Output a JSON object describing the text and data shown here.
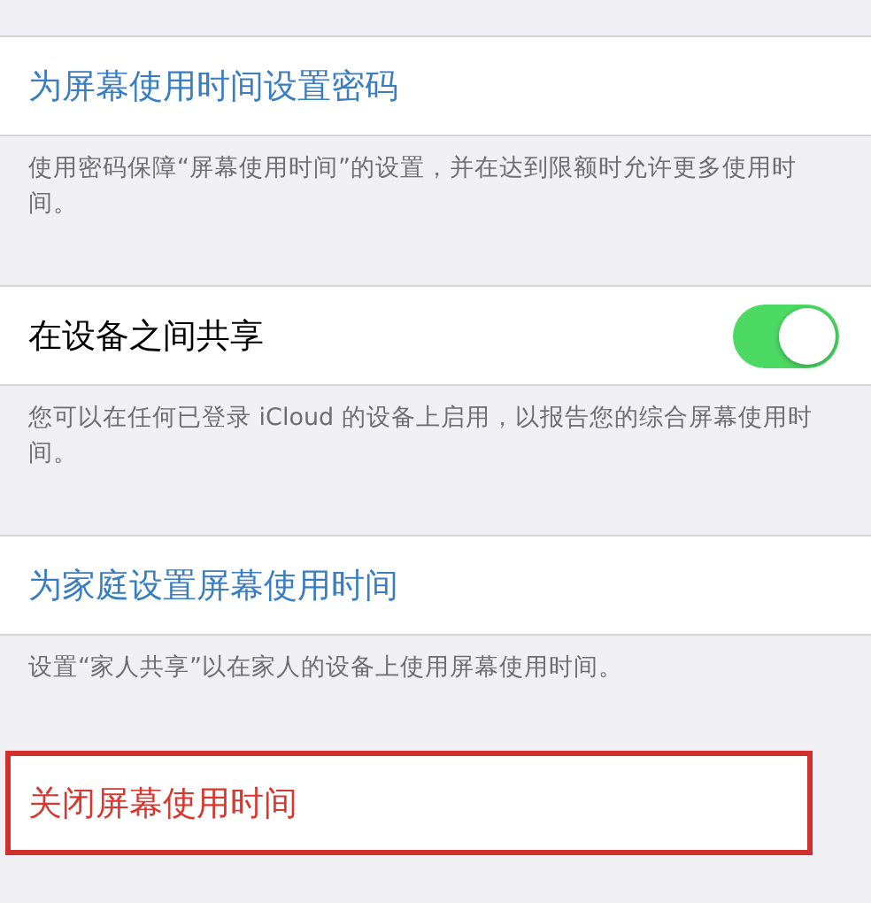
{
  "sections": [
    {
      "kind": "link",
      "label": "为屏幕使用时间设置密码",
      "footer": "使用密码保障“屏幕使用时间”的设置，并在达到限额时允许更多使用时间。",
      "highlighted": false
    },
    {
      "kind": "toggle",
      "label": "在设备之间共享",
      "on": true,
      "footer": "您可以在任何已登录 iCloud 的设备上启用，以报告您的综合屏幕使用时间。",
      "highlighted": false
    },
    {
      "kind": "link",
      "label": "为家庭设置屏幕使用时间",
      "footer": "设置“家人共享”以在家人的设备上使用屏幕使用时间。",
      "highlighted": false
    },
    {
      "kind": "destructive",
      "label": "关闭屏幕使用时间",
      "highlighted": true
    }
  ]
}
